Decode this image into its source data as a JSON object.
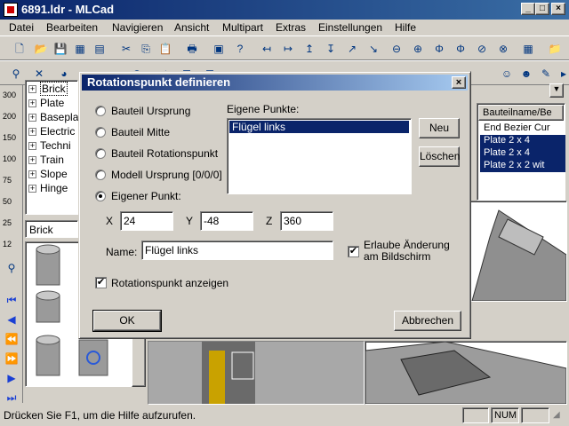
{
  "window": {
    "title": "6891.ldr - MLCad"
  },
  "menu": [
    "Datei",
    "Bearbeiten",
    "Navigieren",
    "Ansicht",
    "Multipart",
    "Extras",
    "Einstellungen",
    "Hilfe"
  ],
  "zoom_labels": [
    "300",
    "200",
    "150",
    "100",
    "75",
    "50",
    "25",
    "12"
  ],
  "tree": [
    "Brick",
    "Plate",
    "Basepla",
    "Electric",
    "Techni",
    "Train",
    "Slope",
    "Hinge"
  ],
  "filter_value": "Brick",
  "parts_list": {
    "header": "Bauteilname/Be",
    "rows": [
      "End Bezier Cur",
      "Plate  2 x  4",
      "Plate  2 x  4",
      "Plate  2 x  2 wit"
    ]
  },
  "dialog": {
    "title": "Rotationspunkt definieren",
    "options": [
      "Bauteil Ursprung",
      "Bauteil Mitte",
      "Bauteil Rotationspunkt",
      "Modell Ursprung [0/0/0]",
      "Eigener Punkt:"
    ],
    "eigene_label": "Eigene Punkte:",
    "eigene_items": [
      "Flügel links"
    ],
    "btn_neu": "Neu",
    "btn_loeschen": "Löschen",
    "x_label": "X",
    "x_value": "24",
    "y_label": "Y",
    "y_value": "-48",
    "z_label": "Z",
    "z_value": "360",
    "name_label": "Name:",
    "name_value": "Flügel links",
    "erlaube_label": "Erlaube Änderung am Bildschirm",
    "show_label": "Rotationspunkt anzeigen",
    "ok": "OK",
    "cancel": "Abbrechen"
  },
  "status": {
    "text": "Drücken Sie F1, um die Hilfe aufzurufen.",
    "num": "NUM"
  }
}
